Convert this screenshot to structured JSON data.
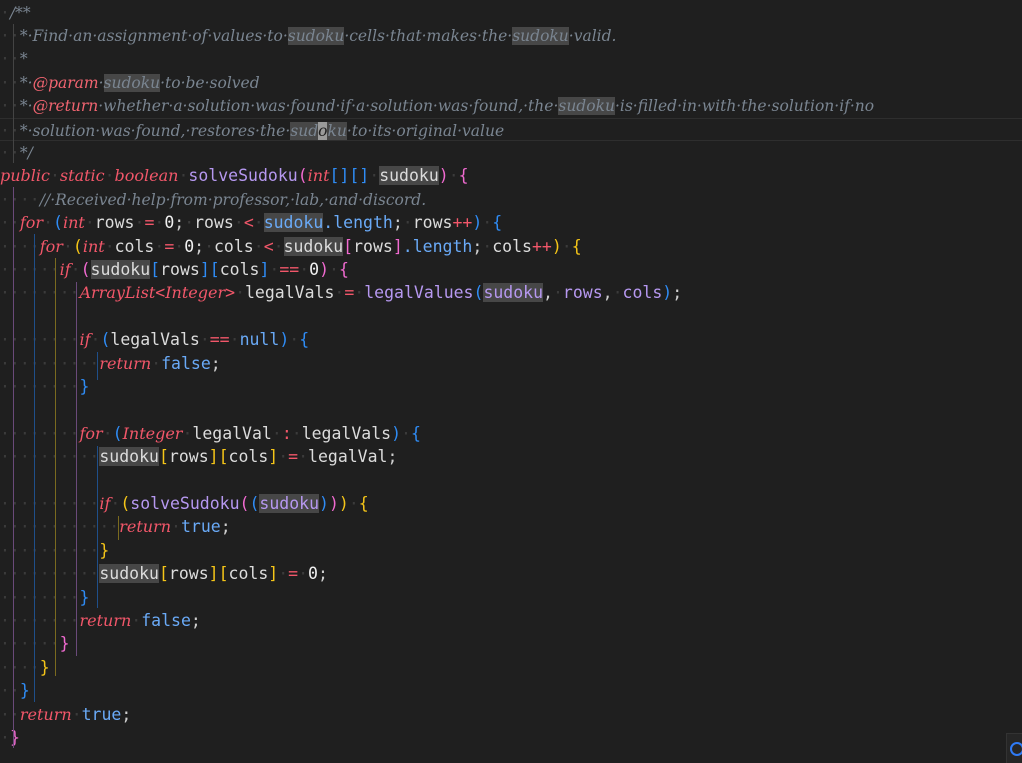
{
  "editor": {
    "language": "java",
    "colors": {
      "background": "#1f1f1f",
      "comment": "#7a8591",
      "keyword": "#f2576a",
      "function": "#b698f0",
      "bracket_pink": "#f06ad0",
      "bracket_blue": "#2f8cf5",
      "bracket_yellow": "#f5c518",
      "word_highlight": "#474747"
    },
    "highlighted_word": "sudoku",
    "lines": [
      [
        [
          "ws",
          "·"
        ],
        [
          "cmt",
          "/**"
        ]
      ],
      [
        [
          "ws",
          "··"
        ],
        [
          "cmt",
          "*·Find·an·assignment·of·values·to·"
        ],
        [
          "cmt hl",
          "sudoku"
        ],
        [
          "cmt",
          "·cells·that·makes·the·"
        ],
        [
          "cmt hl",
          "sudoku"
        ],
        [
          "cmt",
          "·valid."
        ]
      ],
      [
        [
          "ws",
          "··"
        ],
        [
          "cmt",
          "*"
        ]
      ],
      [
        [
          "ws",
          "··"
        ],
        [
          "cmt",
          "*·"
        ],
        [
          "tag",
          "@param"
        ],
        [
          "cmt",
          "·"
        ],
        [
          "cmt hl",
          "sudoku"
        ],
        [
          "cmt",
          "·to·be·solved"
        ]
      ],
      [
        [
          "ws",
          "··"
        ],
        [
          "cmt",
          "*·"
        ],
        [
          "tag",
          "@return"
        ],
        [
          "cmt",
          "·whether·a·solution·was·found·if·a·solution·was·found,·the·"
        ],
        [
          "cmt hl",
          "sudoku"
        ],
        [
          "cmt",
          "·is·filled·in·with·the·solution·if·no"
        ]
      ],
      [
        [
          "ws",
          "··"
        ],
        [
          "cmt",
          "*·solution·was·found,·restores·the·"
        ],
        [
          "cmt hl",
          "sud"
        ],
        [
          "cmt hl-cursor",
          "o"
        ],
        [
          "cmt hl",
          "ku"
        ],
        [
          "cmt",
          "·to·its·original·value"
        ]
      ],
      [
        [
          "ws",
          "··"
        ],
        [
          "cmt",
          "*/"
        ]
      ],
      [
        [
          "kw",
          "public"
        ],
        [
          "ws",
          "·"
        ],
        [
          "kw",
          "static"
        ],
        [
          "ws",
          "·"
        ],
        [
          "kw",
          "boolean"
        ],
        [
          "ws",
          "·"
        ],
        [
          "fn",
          "solveSudoku"
        ],
        [
          "b1",
          "("
        ],
        [
          "type",
          "int"
        ],
        [
          "b2",
          "[][]"
        ],
        [
          "ws",
          "·"
        ],
        [
          "var hl",
          "sudoku"
        ],
        [
          "b1",
          ")"
        ],
        [
          "ws",
          "·"
        ],
        [
          "b1",
          "{"
        ]
      ],
      [
        [
          "ws",
          "····"
        ],
        [
          "cmt",
          "//·Received·help·from·professor,·lab,·and·discord."
        ]
      ],
      [
        [
          "ws",
          "··"
        ],
        [
          "kw",
          "for"
        ],
        [
          "ws",
          "·"
        ],
        [
          "b2",
          "("
        ],
        [
          "type",
          "int"
        ],
        [
          "ws",
          "·"
        ],
        [
          "var",
          "rows"
        ],
        [
          "ws",
          "·"
        ],
        [
          "op",
          "="
        ],
        [
          "ws",
          "·"
        ],
        [
          "num",
          "0"
        ],
        [
          "punc",
          ";"
        ],
        [
          "ws",
          "·"
        ],
        [
          "var",
          "rows"
        ],
        [
          "ws",
          "·"
        ],
        [
          "op",
          "<"
        ],
        [
          "ws",
          "·"
        ],
        [
          "prop hl",
          "sudoku"
        ],
        [
          "prop",
          ".length"
        ],
        [
          "punc",
          ";"
        ],
        [
          "ws",
          "·"
        ],
        [
          "var",
          "rows"
        ],
        [
          "op",
          "++"
        ],
        [
          "b2",
          ")"
        ],
        [
          "ws",
          "·"
        ],
        [
          "b2",
          "{"
        ]
      ],
      [
        [
          "ws",
          "····"
        ],
        [
          "kw",
          "for"
        ],
        [
          "ws",
          "·"
        ],
        [
          "b3",
          "("
        ],
        [
          "type",
          "int"
        ],
        [
          "ws",
          "·"
        ],
        [
          "var",
          "cols"
        ],
        [
          "ws",
          "·"
        ],
        [
          "op",
          "="
        ],
        [
          "ws",
          "·"
        ],
        [
          "num",
          "0"
        ],
        [
          "punc",
          ";"
        ],
        [
          "ws",
          "·"
        ],
        [
          "var",
          "cols"
        ],
        [
          "ws",
          "·"
        ],
        [
          "op",
          "<"
        ],
        [
          "ws",
          "·"
        ],
        [
          "var hl",
          "sudoku"
        ],
        [
          "b1",
          "["
        ],
        [
          "var",
          "rows"
        ],
        [
          "b1",
          "]"
        ],
        [
          "prop",
          ".length"
        ],
        [
          "punc",
          ";"
        ],
        [
          "ws",
          "·"
        ],
        [
          "var",
          "cols"
        ],
        [
          "op",
          "++"
        ],
        [
          "b3",
          ")"
        ],
        [
          "ws",
          "·"
        ],
        [
          "b3",
          "{"
        ]
      ],
      [
        [
          "ws",
          "······"
        ],
        [
          "kw",
          "if"
        ],
        [
          "ws",
          "·"
        ],
        [
          "b1",
          "("
        ],
        [
          "var hl",
          "sudoku"
        ],
        [
          "b2",
          "["
        ],
        [
          "var",
          "rows"
        ],
        [
          "b2",
          "]["
        ],
        [
          "var",
          "cols"
        ],
        [
          "b2",
          "]"
        ],
        [
          "ws",
          "·"
        ],
        [
          "op",
          "=="
        ],
        [
          "ws",
          "·"
        ],
        [
          "num",
          "0"
        ],
        [
          "b1",
          ")"
        ],
        [
          "ws",
          "·"
        ],
        [
          "b1",
          "{"
        ]
      ],
      [
        [
          "ws",
          "········"
        ],
        [
          "type",
          "ArrayList"
        ],
        [
          "op",
          "<"
        ],
        [
          "type",
          "Integer"
        ],
        [
          "op",
          ">"
        ],
        [
          "ws",
          "·"
        ],
        [
          "var",
          "legalVals"
        ],
        [
          "ws",
          "·"
        ],
        [
          "op",
          "="
        ],
        [
          "ws",
          "·"
        ],
        [
          "fn",
          "legalValues"
        ],
        [
          "b2",
          "("
        ],
        [
          "param hl",
          "sudoku"
        ],
        [
          "punc",
          ","
        ],
        [
          "ws",
          "·"
        ],
        [
          "param",
          "rows"
        ],
        [
          "punc",
          ","
        ],
        [
          "ws",
          "·"
        ],
        [
          "param",
          "cols"
        ],
        [
          "b2",
          ")"
        ],
        [
          "punc",
          ";"
        ]
      ],
      [],
      [
        [
          "ws",
          "········"
        ],
        [
          "kw",
          "if"
        ],
        [
          "ws",
          "·"
        ],
        [
          "b2",
          "("
        ],
        [
          "var",
          "legalVals"
        ],
        [
          "ws",
          "·"
        ],
        [
          "op",
          "=="
        ],
        [
          "ws",
          "·"
        ],
        [
          "lit",
          "null"
        ],
        [
          "b2",
          ")"
        ],
        [
          "ws",
          "·"
        ],
        [
          "b2",
          "{"
        ]
      ],
      [
        [
          "ws",
          "··········"
        ],
        [
          "kw",
          "return"
        ],
        [
          "ws",
          "·"
        ],
        [
          "lit",
          "false"
        ],
        [
          "punc",
          ";"
        ]
      ],
      [
        [
          "ws",
          "········"
        ],
        [
          "b2",
          "}"
        ]
      ],
      [],
      [
        [
          "ws",
          "········"
        ],
        [
          "kw",
          "for"
        ],
        [
          "ws",
          "·"
        ],
        [
          "b2",
          "("
        ],
        [
          "type",
          "Integer"
        ],
        [
          "ws",
          "·"
        ],
        [
          "var",
          "legalVal"
        ],
        [
          "ws",
          "·"
        ],
        [
          "op",
          ":"
        ],
        [
          "ws",
          "·"
        ],
        [
          "var",
          "legalVals"
        ],
        [
          "b2",
          ")"
        ],
        [
          "ws",
          "·"
        ],
        [
          "b2",
          "{"
        ]
      ],
      [
        [
          "ws",
          "··········"
        ],
        [
          "var hl",
          "sudoku"
        ],
        [
          "b3",
          "["
        ],
        [
          "var",
          "rows"
        ],
        [
          "b3",
          "]["
        ],
        [
          "var",
          "cols"
        ],
        [
          "b3",
          "]"
        ],
        [
          "ws",
          "·"
        ],
        [
          "op",
          "="
        ],
        [
          "ws",
          "·"
        ],
        [
          "var",
          "legalVal"
        ],
        [
          "punc",
          ";"
        ]
      ],
      [],
      [
        [
          "ws",
          "··········"
        ],
        [
          "kw",
          "if"
        ],
        [
          "ws",
          "·"
        ],
        [
          "b3",
          "("
        ],
        [
          "fn",
          "solveSudoku"
        ],
        [
          "b1",
          "("
        ],
        [
          "b2",
          "("
        ],
        [
          "param hl",
          "sudoku"
        ],
        [
          "b2",
          ")"
        ],
        [
          "b1",
          ")"
        ],
        [
          "b3",
          ")"
        ],
        [
          "ws",
          "·"
        ],
        [
          "b3",
          "{"
        ]
      ],
      [
        [
          "ws",
          "············"
        ],
        [
          "kw",
          "return"
        ],
        [
          "ws",
          "·"
        ],
        [
          "lit",
          "true"
        ],
        [
          "punc",
          ";"
        ]
      ],
      [
        [
          "ws",
          "··········"
        ],
        [
          "b3",
          "}"
        ]
      ],
      [
        [
          "ws",
          "··········"
        ],
        [
          "var hl",
          "sudoku"
        ],
        [
          "b3",
          "["
        ],
        [
          "var",
          "rows"
        ],
        [
          "b3",
          "]["
        ],
        [
          "var",
          "cols"
        ],
        [
          "b3",
          "]"
        ],
        [
          "ws",
          "·"
        ],
        [
          "op",
          "="
        ],
        [
          "ws",
          "·"
        ],
        [
          "num",
          "0"
        ],
        [
          "punc",
          ";"
        ]
      ],
      [
        [
          "ws",
          "········"
        ],
        [
          "b2",
          "}"
        ]
      ],
      [
        [
          "ws",
          "········"
        ],
        [
          "kw",
          "return"
        ],
        [
          "ws",
          "·"
        ],
        [
          "lit",
          "false"
        ],
        [
          "punc",
          ";"
        ]
      ],
      [
        [
          "ws",
          "······"
        ],
        [
          "b1",
          "}"
        ]
      ],
      [
        [
          "ws",
          "····"
        ],
        [
          "b3",
          "}"
        ]
      ],
      [
        [
          "ws",
          "··"
        ],
        [
          "b2",
          "}"
        ]
      ],
      [
        [
          "ws",
          "··"
        ],
        [
          "kw",
          "return"
        ],
        [
          "ws",
          "·"
        ],
        [
          "lit",
          "true"
        ],
        [
          "punc",
          ";"
        ]
      ],
      [
        [
          "ws",
          "·"
        ],
        [
          "b1",
          "}"
        ]
      ]
    ]
  }
}
